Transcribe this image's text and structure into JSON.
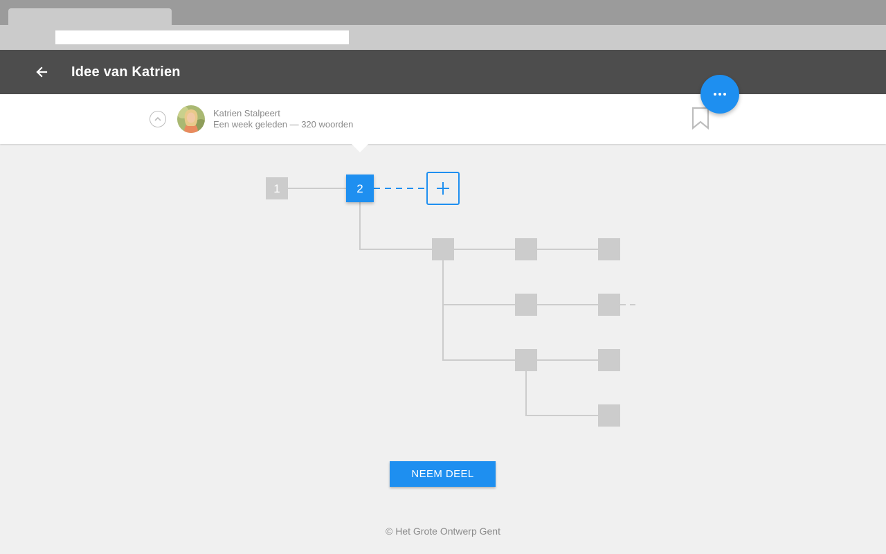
{
  "browser": {
    "tab_title": "",
    "address": ""
  },
  "appbar": {
    "title": "Idee van Katrien",
    "back_icon": "arrow-left-icon"
  },
  "post": {
    "author": "Katrien Stalpeert",
    "meta": "Een week geleden — 320 woorden",
    "collapse_icon": "chevron-up-icon",
    "bookmark_icon": "bookmark-icon"
  },
  "fab": {
    "icon": "more-horizontal-icon"
  },
  "tree": {
    "nodes": [
      {
        "label": "1",
        "state": "previous"
      },
      {
        "label": "2",
        "state": "current"
      },
      {
        "label": "+",
        "state": "add"
      }
    ]
  },
  "cta": {
    "label": "NEEM DEEL"
  },
  "footer": {
    "text": "© Het Grote Ontwerp Gent"
  },
  "colors": {
    "accent": "#1e8ff0",
    "appbar": "#4d4d4d",
    "node_inactive": "#cccccc",
    "background": "#f0f0f0"
  }
}
